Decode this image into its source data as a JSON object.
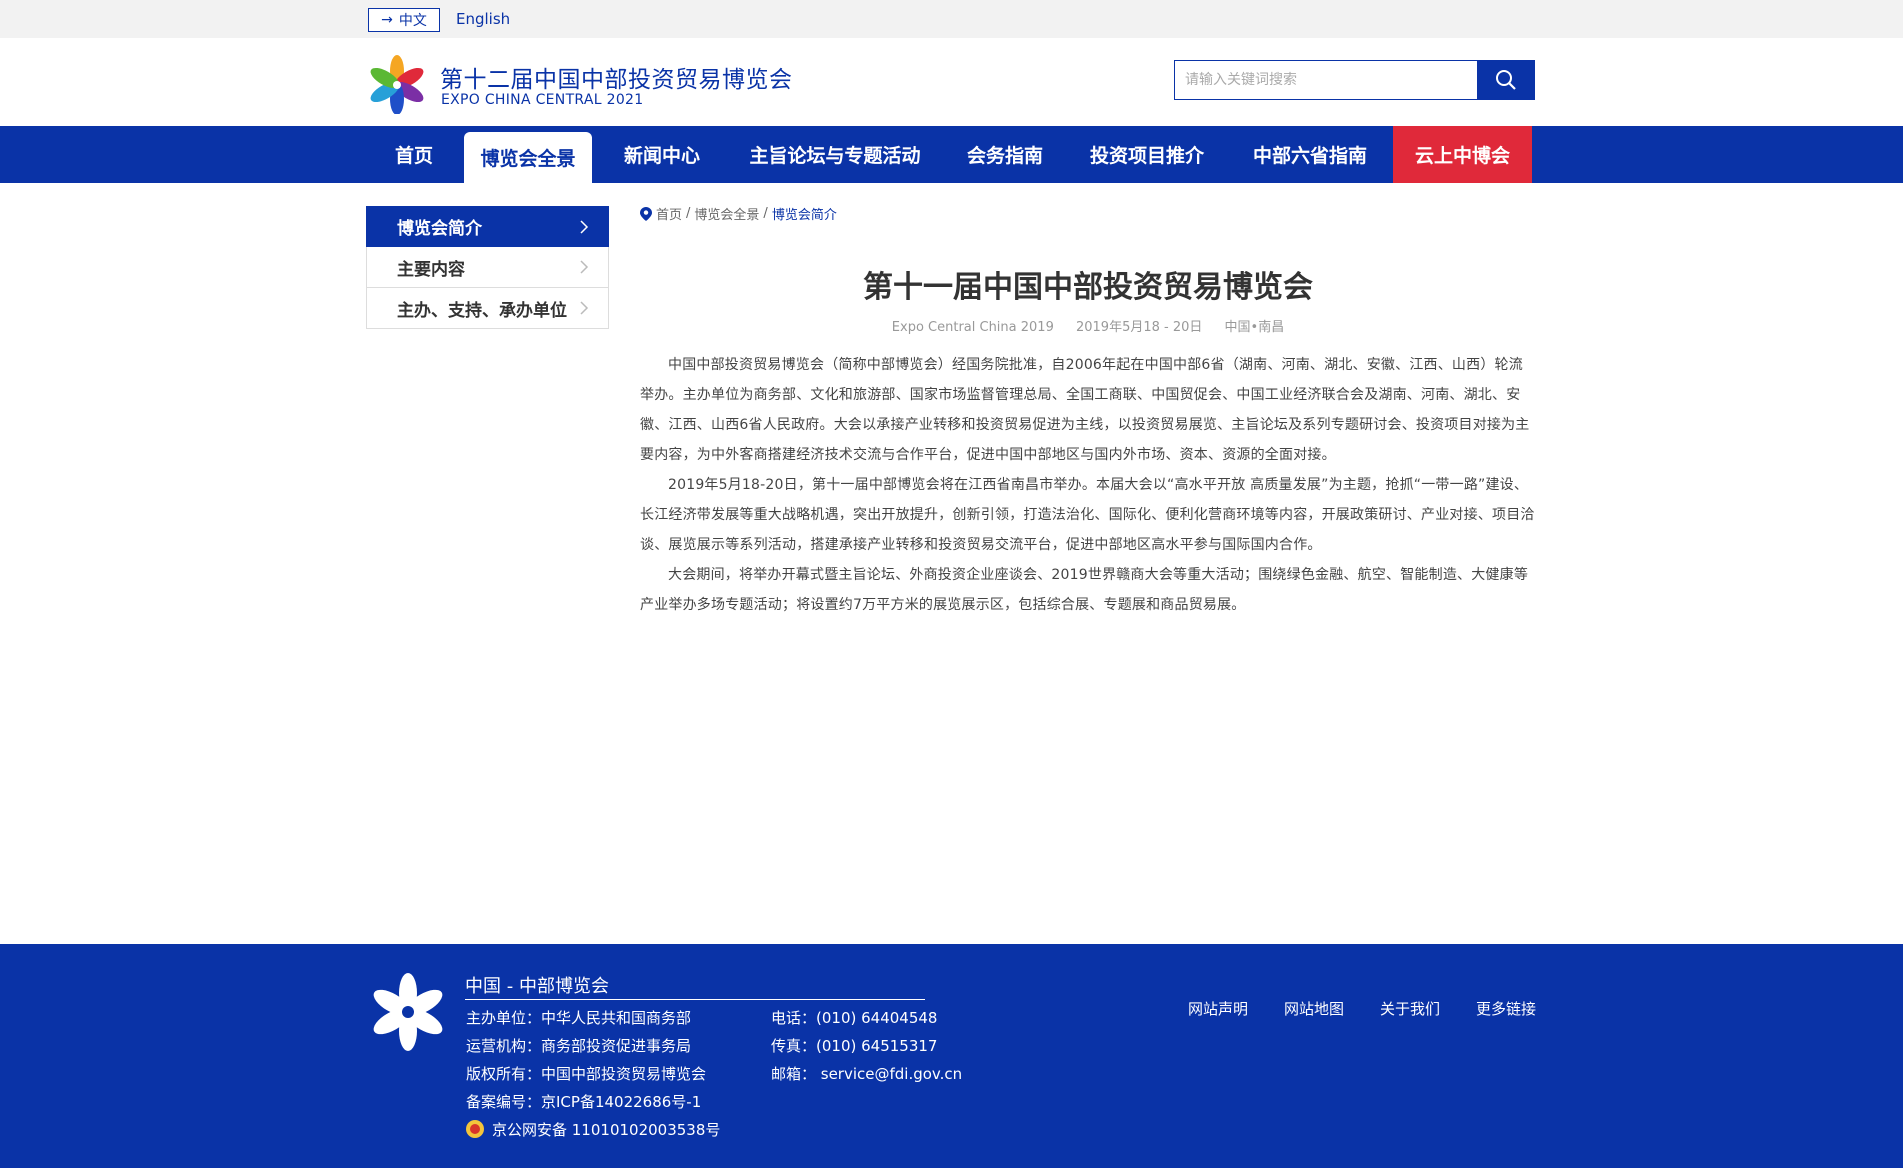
{
  "lang": {
    "cn": "中文",
    "en": "English"
  },
  "header": {
    "title_cn": "第十二届中国中部投资贸易博览会",
    "title_en": "EXPO CHINA CENTRAL 2021",
    "search_placeholder": "请输入关键词搜索"
  },
  "nav": {
    "items": [
      {
        "label": "首页"
      },
      {
        "label": "博览会全景"
      },
      {
        "label": "新闻中心"
      },
      {
        "label": "主旨论坛与专题活动"
      },
      {
        "label": "会务指南"
      },
      {
        "label": "投资项目推介"
      },
      {
        "label": "中部六省指南"
      },
      {
        "label": "云上中博会"
      }
    ]
  },
  "sidebar": {
    "items": [
      {
        "label": "博览会简介"
      },
      {
        "label": "主要内容"
      },
      {
        "label": "主办、支持、承办单位"
      }
    ]
  },
  "breadcrumb": {
    "home": "首页",
    "sep": "/",
    "parent": "博览会全景",
    "current": "博览会简介"
  },
  "article": {
    "title": "第十一届中国中部投资贸易博览会",
    "meta_en": "Expo Central China 2019",
    "meta_date": "2019年5月18 - 20日",
    "meta_place": "中国•南昌",
    "paragraphs": [
      "中国中部投资贸易博览会（简称中部博览会）经国务院批准，自2006年起在中国中部6省（湖南、河南、湖北、安徽、江西、山西）轮流举办。主办单位为商务部、文化和旅游部、国家市场监督管理总局、全国工商联、中国贸促会、中国工业经济联合会及湖南、河南、湖北、安徽、江西、山西6省人民政府。大会以承接产业转移和投资贸易促进为主线，以投资贸易展览、主旨论坛及系列专题研讨会、投资项目对接为主要内容，为中外客商搭建经济技术交流与合作平台，促进中国中部地区与国内外市场、资本、资源的全面对接。",
      "2019年5月18-20日，第十一届中部博览会将在江西省南昌市举办。本届大会以“高水平开放 高质量发展”为主题，抢抓“一带一路”建设、长江经济带发展等重大战略机遇，突出开放提升，创新引领，打造法治化、国际化、便利化营商环境等内容，开展政策研讨、产业对接、项目洽谈、展览展示等系列活动，搭建承接产业转移和投资贸易交流平台，促进中部地区高水平参与国际国内合作。",
      "大会期间，将举办开幕式暨主旨论坛、外商投资企业座谈会、2019世界赣商大会等重大活动；围绕绿色金融、航空、智能制造、大健康等产业举办多场专题活动；将设置约7万平方米的展览展示区，包括综合展、专题展和商品贸易展。"
    ]
  },
  "footer": {
    "title": "中国 - 中部博览会",
    "col1": [
      "主办单位：中华人民共和国商务部",
      "运营机构：商务部投资促进事务局",
      "版权所有：中国中部投资贸易博览会",
      "备案编号：京ICP备14022686号-1",
      "京公网安备 11010102003538号"
    ],
    "col2": [
      "电话：(010) 64404548",
      "传真：(010) 64515317",
      "邮箱： service@fdi.gov.cn"
    ],
    "links": [
      "网站声明",
      "网站地图",
      "关于我们",
      "更多链接"
    ]
  },
  "colors": {
    "brand_blue": "#0a33a7",
    "accent_red": "#e0293a"
  },
  "icons": [
    "arrow-right-icon",
    "search-icon",
    "chevron-right-icon",
    "location-pin-icon",
    "police-badge-icon"
  ]
}
